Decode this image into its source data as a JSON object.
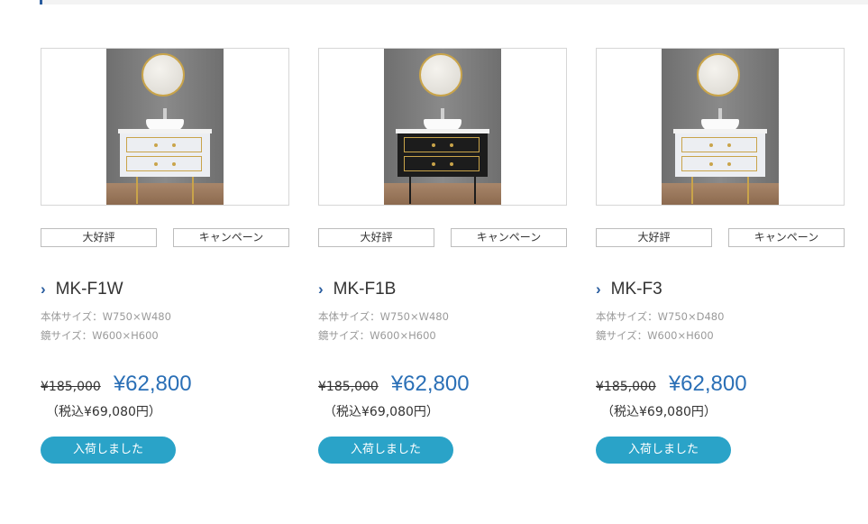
{
  "products": [
    {
      "tags": [
        "大好評",
        "キャンペーン"
      ],
      "name": "MK-F1W",
      "spec_body": "本体サイズ：W750×W480",
      "spec_mirror": "鏡サイズ：W600×H600",
      "old_price": "¥185,000",
      "new_price": "¥62,800",
      "tax_included": "（税込¥69,080円）",
      "button": "入荷しました"
    },
    {
      "tags": [
        "大好評",
        "キャンペーン"
      ],
      "name": "MK-F1B",
      "spec_body": "本体サイズ：W750×W480",
      "spec_mirror": "鏡サイズ：W600×H600",
      "old_price": "¥185,000",
      "new_price": "¥62,800",
      "tax_included": "（税込¥69,080円）",
      "button": "入荷しました"
    },
    {
      "tags": [
        "大好評",
        "キャンペーン"
      ],
      "name": "MK-F3",
      "spec_body": "本体サイズ：W750×D480",
      "spec_mirror": "鏡サイズ：W600×H600",
      "old_price": "¥185,000",
      "new_price": "¥62,800",
      "tax_included": "（税込¥69,080円）",
      "button": "入荷しました"
    }
  ],
  "colors": {
    "accent": "#2a5d9f",
    "price": "#2a6fb6",
    "button": "#2aa3c8"
  },
  "icons": {
    "name_marker": "chevron-right-icon"
  }
}
